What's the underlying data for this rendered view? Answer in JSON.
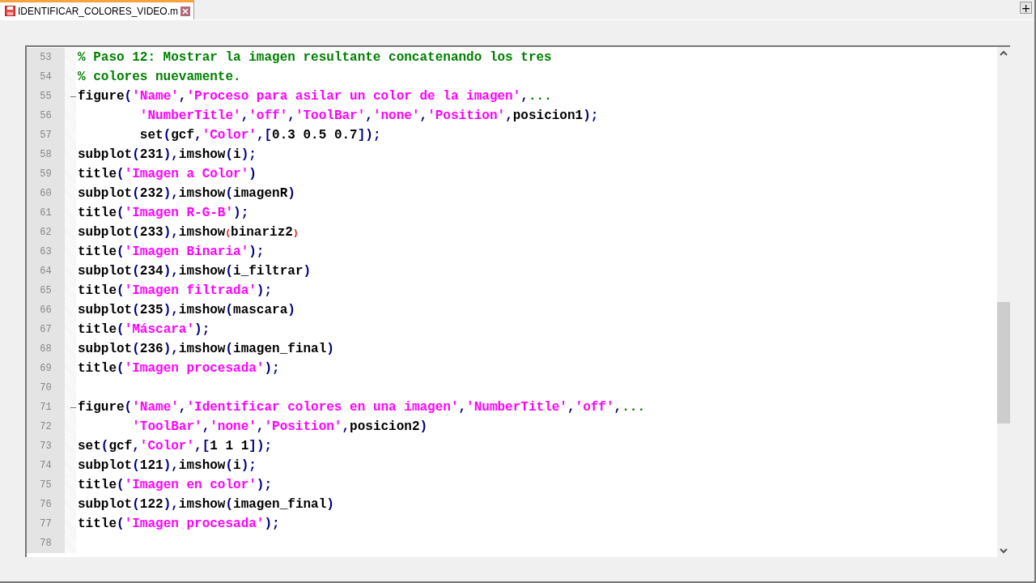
{
  "tab": {
    "label": "IDENTIFICAR_COLORES_VIDEO.m",
    "selected": true
  },
  "new_tab_button": "+",
  "editor": {
    "lines": [
      {
        "number": "53",
        "fold": false,
        "tokens": [
          {
            "kind": "comment",
            "text": "% Paso 12: Mostrar la imagen resultante concatenando los tres"
          }
        ]
      },
      {
        "number": "54",
        "fold": false,
        "tokens": [
          {
            "kind": "comment",
            "text": "% colores nuevamente."
          }
        ]
      },
      {
        "number": "55",
        "fold": true,
        "tokens": [
          {
            "kind": "text",
            "text": "figure"
          },
          {
            "kind": "punct",
            "text": "("
          },
          {
            "kind": "str",
            "text": "'Name'"
          },
          {
            "kind": "punct",
            "text": ","
          },
          {
            "kind": "str",
            "text": "'Proceso para asilar un color de la imagen'"
          },
          {
            "kind": "punct",
            "text": ","
          },
          {
            "kind": "comment",
            "text": "..."
          }
        ]
      },
      {
        "number": "56",
        "fold": false,
        "tokens": [
          {
            "kind": "str",
            "text": "        'NumberTitle'"
          },
          {
            "kind": "punct",
            "text": ","
          },
          {
            "kind": "str",
            "text": "'off'"
          },
          {
            "kind": "punct",
            "text": ","
          },
          {
            "kind": "str",
            "text": "'ToolBar'"
          },
          {
            "kind": "punct",
            "text": ","
          },
          {
            "kind": "str",
            "text": "'none'"
          },
          {
            "kind": "punct",
            "text": ","
          },
          {
            "kind": "str",
            "text": "'Position'"
          },
          {
            "kind": "punct",
            "text": ","
          },
          {
            "kind": "text",
            "text": "posicion1"
          },
          {
            "kind": "punct",
            "text": ");"
          }
        ]
      },
      {
        "number": "57",
        "fold": false,
        "tokens": [
          {
            "kind": "text",
            "text": "        set"
          },
          {
            "kind": "punct",
            "text": "("
          },
          {
            "kind": "text",
            "text": "gcf"
          },
          {
            "kind": "punct",
            "text": ","
          },
          {
            "kind": "str",
            "text": "'Color'"
          },
          {
            "kind": "punct",
            "text": ",["
          },
          {
            "kind": "text",
            "text": "0.3 0.5 0.7"
          },
          {
            "kind": "punct",
            "text": "]);"
          }
        ]
      },
      {
        "number": "58",
        "fold": false,
        "tokens": [
          {
            "kind": "text",
            "text": "subplot"
          },
          {
            "kind": "punct",
            "text": "("
          },
          {
            "kind": "text",
            "text": "231"
          },
          {
            "kind": "punct",
            "text": "),"
          },
          {
            "kind": "text",
            "text": "imshow"
          },
          {
            "kind": "punct",
            "text": "("
          },
          {
            "kind": "text",
            "text": "i"
          },
          {
            "kind": "punct",
            "text": ");"
          }
        ]
      },
      {
        "number": "59",
        "fold": false,
        "tokens": [
          {
            "kind": "text",
            "text": "title"
          },
          {
            "kind": "punct",
            "text": "("
          },
          {
            "kind": "str",
            "text": "'Imagen a Color'"
          },
          {
            "kind": "punct",
            "text": ")"
          }
        ]
      },
      {
        "number": "60",
        "fold": false,
        "tokens": [
          {
            "kind": "text",
            "text": "subplot"
          },
          {
            "kind": "punct",
            "text": "("
          },
          {
            "kind": "text",
            "text": "232"
          },
          {
            "kind": "punct",
            "text": "),"
          },
          {
            "kind": "text",
            "text": "imshow"
          },
          {
            "kind": "punct",
            "text": "("
          },
          {
            "kind": "text",
            "text": "imagenR"
          },
          {
            "kind": "punct",
            "text": ")"
          }
        ]
      },
      {
        "number": "61",
        "fold": false,
        "tokens": [
          {
            "kind": "text",
            "text": "title"
          },
          {
            "kind": "punct",
            "text": "("
          },
          {
            "kind": "str",
            "text": "'Imagen R-G-B'"
          },
          {
            "kind": "punct",
            "text": ");"
          }
        ]
      },
      {
        "number": "62",
        "fold": false,
        "tokens": [
          {
            "kind": "text",
            "text": "subplot"
          },
          {
            "kind": "punct",
            "text": "("
          },
          {
            "kind": "text",
            "text": "233"
          },
          {
            "kind": "punct",
            "text": "),"
          },
          {
            "kind": "text",
            "text": "imshow"
          },
          {
            "kind": "error",
            "text": "("
          },
          {
            "kind": "text",
            "text": "binariz2"
          },
          {
            "kind": "error",
            "text": ")"
          }
        ]
      },
      {
        "number": "63",
        "fold": false,
        "tokens": [
          {
            "kind": "text",
            "text": "title"
          },
          {
            "kind": "punct",
            "text": "("
          },
          {
            "kind": "str",
            "text": "'Imagen Binaria'"
          },
          {
            "kind": "punct",
            "text": ");"
          }
        ]
      },
      {
        "number": "64",
        "fold": false,
        "tokens": [
          {
            "kind": "text",
            "text": "subplot"
          },
          {
            "kind": "punct",
            "text": "("
          },
          {
            "kind": "text",
            "text": "234"
          },
          {
            "kind": "punct",
            "text": "),"
          },
          {
            "kind": "text",
            "text": "imshow"
          },
          {
            "kind": "punct",
            "text": "("
          },
          {
            "kind": "text",
            "text": "i_filtrar"
          },
          {
            "kind": "punct",
            "text": ")"
          }
        ]
      },
      {
        "number": "65",
        "fold": false,
        "tokens": [
          {
            "kind": "text",
            "text": "title"
          },
          {
            "kind": "punct",
            "text": "("
          },
          {
            "kind": "str",
            "text": "'Imagen filtrada'"
          },
          {
            "kind": "punct",
            "text": ");"
          }
        ]
      },
      {
        "number": "66",
        "fold": false,
        "tokens": [
          {
            "kind": "text",
            "text": "subplot"
          },
          {
            "kind": "punct",
            "text": "("
          },
          {
            "kind": "text",
            "text": "235"
          },
          {
            "kind": "punct",
            "text": "),"
          },
          {
            "kind": "text",
            "text": "imshow"
          },
          {
            "kind": "punct",
            "text": "("
          },
          {
            "kind": "text",
            "text": "mascara"
          },
          {
            "kind": "punct",
            "text": ")"
          }
        ]
      },
      {
        "number": "67",
        "fold": false,
        "tokens": [
          {
            "kind": "text",
            "text": "title"
          },
          {
            "kind": "punct",
            "text": "("
          },
          {
            "kind": "str",
            "text": "'Máscara'"
          },
          {
            "kind": "punct",
            "text": ");"
          }
        ]
      },
      {
        "number": "68",
        "fold": false,
        "tokens": [
          {
            "kind": "text",
            "text": "subplot"
          },
          {
            "kind": "punct",
            "text": "("
          },
          {
            "kind": "text",
            "text": "236"
          },
          {
            "kind": "punct",
            "text": "),"
          },
          {
            "kind": "text",
            "text": "imshow"
          },
          {
            "kind": "punct",
            "text": "("
          },
          {
            "kind": "text",
            "text": "imagen_final"
          },
          {
            "kind": "punct",
            "text": ")"
          }
        ]
      },
      {
        "number": "69",
        "fold": false,
        "tokens": [
          {
            "kind": "text",
            "text": "title"
          },
          {
            "kind": "punct",
            "text": "("
          },
          {
            "kind": "str",
            "text": "'Imagen procesada'"
          },
          {
            "kind": "punct",
            "text": ");"
          }
        ]
      },
      {
        "number": "70",
        "fold": false
      },
      {
        "number": "71",
        "fold": true,
        "tokens": [
          {
            "kind": "text",
            "text": "figure"
          },
          {
            "kind": "punct",
            "text": "("
          },
          {
            "kind": "str",
            "text": "'Name'"
          },
          {
            "kind": "punct",
            "text": ","
          },
          {
            "kind": "str",
            "text": "'Identificar colores en una imagen'"
          },
          {
            "kind": "punct",
            "text": ","
          },
          {
            "kind": "str",
            "text": "'NumberTitle'"
          },
          {
            "kind": "punct",
            "text": ","
          },
          {
            "kind": "str",
            "text": "'off'"
          },
          {
            "kind": "punct",
            "text": ","
          },
          {
            "kind": "comment",
            "text": "..."
          }
        ]
      },
      {
        "number": "72",
        "fold": false,
        "tokens": [
          {
            "kind": "str",
            "text": "       'ToolBar'"
          },
          {
            "kind": "punct",
            "text": ","
          },
          {
            "kind": "str",
            "text": "'none'"
          },
          {
            "kind": "punct",
            "text": ","
          },
          {
            "kind": "str",
            "text": "'Position'"
          },
          {
            "kind": "punct",
            "text": ","
          },
          {
            "kind": "text",
            "text": "posicion2"
          },
          {
            "kind": "punct",
            "text": ")"
          }
        ]
      },
      {
        "number": "73",
        "fold": false,
        "tokens": [
          {
            "kind": "text",
            "text": "set"
          },
          {
            "kind": "punct",
            "text": "("
          },
          {
            "kind": "text",
            "text": "gcf"
          },
          {
            "kind": "punct",
            "text": ","
          },
          {
            "kind": "str",
            "text": "'Color'"
          },
          {
            "kind": "punct",
            "text": ",["
          },
          {
            "kind": "text",
            "text": "1 1 1"
          },
          {
            "kind": "punct",
            "text": "]);"
          }
        ]
      },
      {
        "number": "74",
        "fold": false,
        "tokens": [
          {
            "kind": "text",
            "text": "subplot"
          },
          {
            "kind": "punct",
            "text": "("
          },
          {
            "kind": "text",
            "text": "121"
          },
          {
            "kind": "punct",
            "text": "),"
          },
          {
            "kind": "text",
            "text": "imshow"
          },
          {
            "kind": "punct",
            "text": "("
          },
          {
            "kind": "text",
            "text": "i"
          },
          {
            "kind": "punct",
            "text": ");"
          }
        ]
      },
      {
        "number": "75",
        "fold": false,
        "tokens": [
          {
            "kind": "text",
            "text": "title"
          },
          {
            "kind": "punct",
            "text": "("
          },
          {
            "kind": "str",
            "text": "'Imagen en color'"
          },
          {
            "kind": "punct",
            "text": ");"
          }
        ]
      },
      {
        "number": "76",
        "fold": false,
        "tokens": [
          {
            "kind": "text",
            "text": "subplot"
          },
          {
            "kind": "punct",
            "text": "("
          },
          {
            "kind": "text",
            "text": "122"
          },
          {
            "kind": "punct",
            "text": "),"
          },
          {
            "kind": "text",
            "text": "imshow"
          },
          {
            "kind": "punct",
            "text": "("
          },
          {
            "kind": "text",
            "text": "imagen_final"
          },
          {
            "kind": "punct",
            "text": ")"
          }
        ]
      },
      {
        "number": "77",
        "fold": false,
        "tokens": [
          {
            "kind": "text",
            "text": "title"
          },
          {
            "kind": "punct",
            "text": "("
          },
          {
            "kind": "str",
            "text": "'Imagen procesada'"
          },
          {
            "kind": "punct",
            "text": ");"
          }
        ]
      },
      {
        "number": "78",
        "fold": false
      }
    ]
  }
}
